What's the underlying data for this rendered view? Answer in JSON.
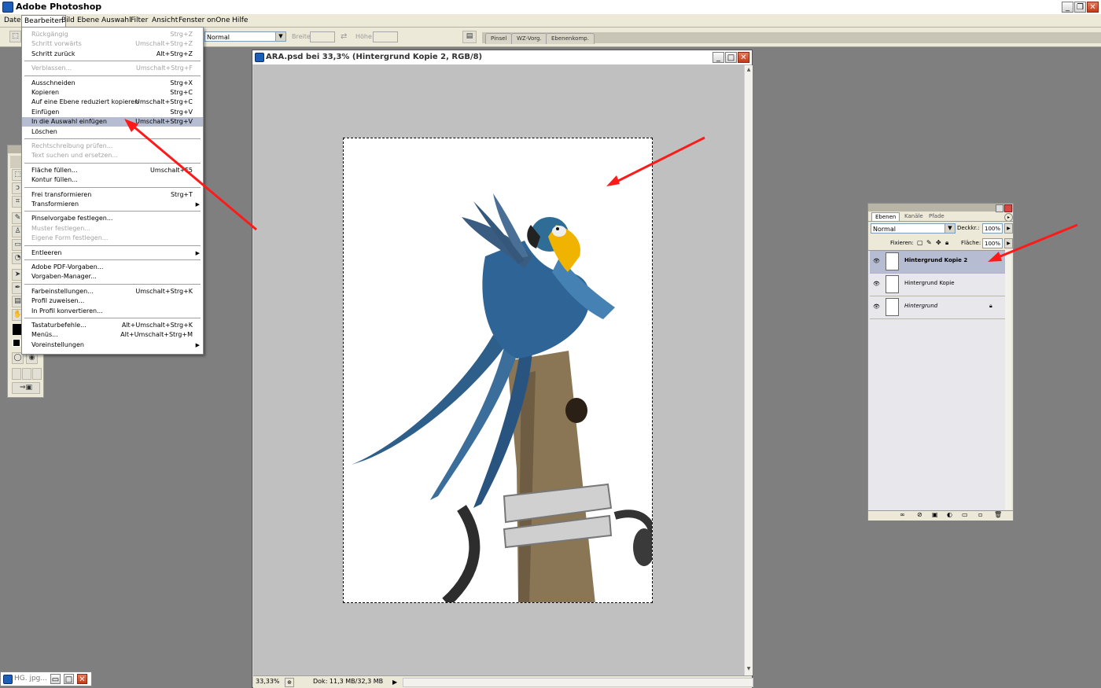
{
  "app": {
    "title": "Adobe Photoshop"
  },
  "menubar": [
    "Datei",
    "Bearbeiten",
    "Bild",
    "Ebene",
    "Auswahl",
    "Filter",
    "Ansicht",
    "Fenster",
    "onOne",
    "Hilfe"
  ],
  "options": {
    "mode": "Normal",
    "width_label": "Breite:",
    "height_label": "Höhe:",
    "tabs": [
      "Pinsel",
      "WZ-Vorg.",
      "Ebenenkomp."
    ]
  },
  "edit_menu": {
    "items": [
      {
        "label": "Rückgängig",
        "shortcut": "Strg+Z",
        "disabled": true
      },
      {
        "label": "Schritt vorwärts",
        "shortcut": "Umschalt+Strg+Z",
        "disabled": true
      },
      {
        "label": "Schritt zurück",
        "shortcut": "Alt+Strg+Z"
      },
      {
        "sep": true
      },
      {
        "label": "Verblassen...",
        "shortcut": "Umschalt+Strg+F",
        "disabled": true
      },
      {
        "sep": true
      },
      {
        "label": "Ausschneiden",
        "shortcut": "Strg+X"
      },
      {
        "label": "Kopieren",
        "shortcut": "Strg+C"
      },
      {
        "label": "Auf eine Ebene reduziert kopieren",
        "shortcut": "Umschalt+Strg+C"
      },
      {
        "label": "Einfügen",
        "shortcut": "Strg+V"
      },
      {
        "label": "In die Auswahl einfügen",
        "shortcut": "Umschalt+Strg+V",
        "highlight": true
      },
      {
        "label": "Löschen",
        "shortcut": ""
      },
      {
        "sep": true
      },
      {
        "label": "Rechtschreibung prüfen...",
        "shortcut": "",
        "disabled": true
      },
      {
        "label": "Text suchen und ersetzen...",
        "shortcut": "",
        "disabled": true
      },
      {
        "sep": true
      },
      {
        "label": "Fläche füllen...",
        "shortcut": "Umschalt+F5"
      },
      {
        "label": "Kontur füllen...",
        "shortcut": ""
      },
      {
        "sep": true
      },
      {
        "label": "Frei transformieren",
        "shortcut": "Strg+T"
      },
      {
        "label": "Transformieren",
        "shortcut": "",
        "submenu": true
      },
      {
        "sep": true
      },
      {
        "label": "Pinselvorgabe festlegen...",
        "shortcut": ""
      },
      {
        "label": "Muster festlegen...",
        "shortcut": "",
        "disabled": true
      },
      {
        "label": "Eigene Form festlegen...",
        "shortcut": "",
        "disabled": true
      },
      {
        "sep": true
      },
      {
        "label": "Entleeren",
        "shortcut": "",
        "submenu": true
      },
      {
        "sep": true
      },
      {
        "label": "Adobe PDF-Vorgaben...",
        "shortcut": ""
      },
      {
        "label": "Vorgaben-Manager...",
        "shortcut": ""
      },
      {
        "sep": true
      },
      {
        "label": "Farbeinstellungen...",
        "shortcut": "Umschalt+Strg+K"
      },
      {
        "label": "Profil zuweisen...",
        "shortcut": ""
      },
      {
        "label": "In Profil konvertieren...",
        "shortcut": ""
      },
      {
        "sep": true
      },
      {
        "label": "Tastaturbefehle...",
        "shortcut": "Alt+Umschalt+Strg+K"
      },
      {
        "label": "Menüs...",
        "shortcut": "Alt+Umschalt+Strg+M"
      },
      {
        "label": "Voreinstellungen",
        "shortcut": "",
        "submenu": true
      }
    ]
  },
  "document": {
    "title": "ARA.psd bei 33,3% (Hintergrund Kopie 2, RGB/8)",
    "zoom": "33,33%",
    "doc_info": "Dok: 11,3 MB/32,3 MB"
  },
  "layers_panel": {
    "tabs": [
      "Ebenen",
      "Kanäle",
      "Pfade"
    ],
    "blend_mode": "Normal",
    "opacity_label": "Deckkr.:",
    "opacity": "100%",
    "lock_label": "Fixieren:",
    "fill_label": "Fläche:",
    "fill": "100%",
    "layers": [
      {
        "name": "Hintergrund Kopie 2",
        "selected": true
      },
      {
        "name": "Hintergrund Kopie"
      },
      {
        "name": "Hintergrund",
        "locked": true
      }
    ]
  },
  "minimized": {
    "title": "HG. jpg..."
  },
  "colors": {
    "annotation_arrow": "#ff1a1a",
    "menu_highlight": "#b6bdd2",
    "workspace": "#7f7f7f"
  }
}
